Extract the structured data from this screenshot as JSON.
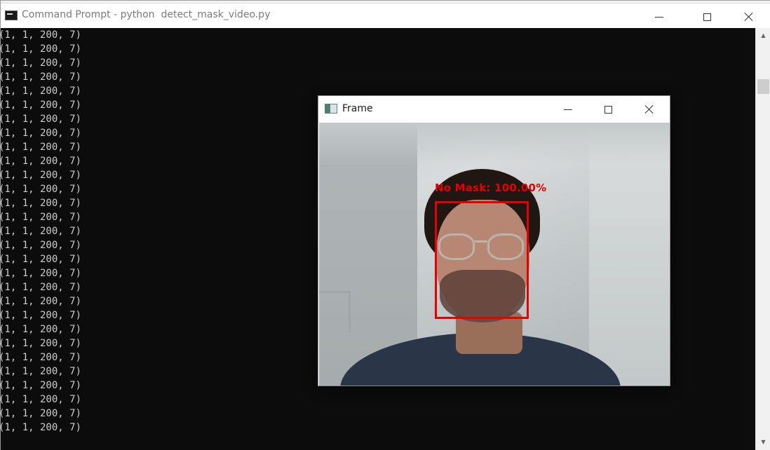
{
  "cmd_window": {
    "title": "Command Prompt - python  detect_mask_video.py",
    "console_lines": [
      "(1, 1, 200, 7)",
      "(1, 1, 200, 7)",
      "(1, 1, 200, 7)",
      "(1, 1, 200, 7)",
      "(1, 1, 200, 7)",
      "(1, 1, 200, 7)",
      "(1, 1, 200, 7)",
      "(1, 1, 200, 7)",
      "(1, 1, 200, 7)",
      "(1, 1, 200, 7)",
      "(1, 1, 200, 7)",
      "(1, 1, 200, 7)",
      "(1, 1, 200, 7)",
      "(1, 1, 200, 7)",
      "(1, 1, 200, 7)",
      "(1, 1, 200, 7)",
      "(1, 1, 200, 7)",
      "(1, 1, 200, 7)",
      "(1, 1, 200, 7)",
      "(1, 1, 200, 7)",
      "(1, 1, 200, 7)",
      "(1, 1, 200, 7)",
      "(1, 1, 200, 7)",
      "(1, 1, 200, 7)",
      "(1, 1, 200, 7)",
      "(1, 1, 200, 7)",
      "(1, 1, 200, 7)",
      "(1, 1, 200, 7)",
      "(1, 1, 200, 7)"
    ],
    "icons": {
      "app": "command-prompt-icon",
      "minimize": "minimize-icon",
      "maximize": "maximize-icon",
      "close": "close-icon"
    }
  },
  "frame_window": {
    "title": "Frame",
    "detection_label": "No Mask: 100.00%",
    "detection_color": "#e60000",
    "icons": {
      "app": "frame-app-icon",
      "minimize": "minimize-icon",
      "maximize": "maximize-icon",
      "close": "close-icon"
    }
  },
  "colors": {
    "console_bg": "#0c0c0c",
    "console_text": "#cccccc"
  }
}
